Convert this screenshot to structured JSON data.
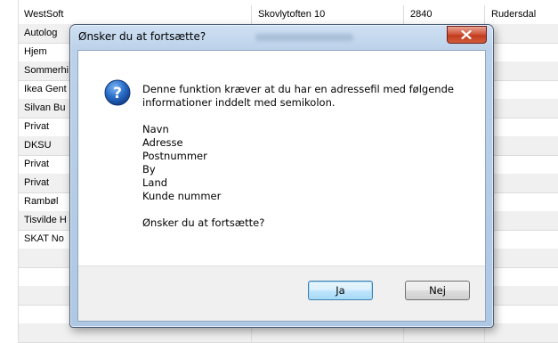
{
  "grid": {
    "rows": [
      {
        "name": "WestSoft",
        "address": "Skovlytoften 10",
        "zip": "2840",
        "city": "Rudersdal"
      },
      {
        "name": "Autolog",
        "address": "",
        "zip": "",
        "city": ""
      },
      {
        "name": "Hjem",
        "address": "",
        "zip": "",
        "city": ""
      },
      {
        "name": "Sommerhi",
        "address": "",
        "zip": "",
        "city": ""
      },
      {
        "name": "Ikea Gent",
        "address": "",
        "zip": "",
        "city": ""
      },
      {
        "name": "Silvan Bu",
        "address": "",
        "zip": "",
        "city": ""
      },
      {
        "name": "Privat",
        "address": "",
        "zip": "",
        "city": ""
      },
      {
        "name": "DKSU",
        "address": "",
        "zip": "",
        "city": ""
      },
      {
        "name": "Privat",
        "address": "",
        "zip": "",
        "city": ""
      },
      {
        "name": "Privat",
        "address": "",
        "zip": "",
        "city": ""
      },
      {
        "name": "Rambøl",
        "address": "",
        "zip": "",
        "city": ""
      },
      {
        "name": "Tisvilde H",
        "address": "",
        "zip": "",
        "city": ""
      },
      {
        "name": "SKAT No",
        "address": "",
        "zip": "",
        "city": ""
      },
      {
        "name": "",
        "address": "",
        "zip": "",
        "city": ""
      },
      {
        "name": "",
        "address": "",
        "zip": "",
        "city": ""
      },
      {
        "name": "",
        "address": "",
        "zip": "",
        "city": ""
      },
      {
        "name": "",
        "address": "",
        "zip": "",
        "city": ""
      },
      {
        "name": "",
        "address": "",
        "zip": "",
        "city": ""
      }
    ]
  },
  "dialog": {
    "title": "Ønsker du at fortsætte?",
    "icon": "information-icon",
    "message_lines": [
      "Denne funktion kræver at du har en adressefil med følgende",
      "informationer inddelt med semikolon."
    ],
    "fields": [
      "Navn",
      "Adresse",
      "Postnummer",
      "By",
      "Land",
      "Kunde nummer"
    ],
    "question": "Ønsker du at fortsætte?",
    "buttons": {
      "yes": "Ja",
      "no": "Nej"
    }
  },
  "colors": {
    "dialog_frame": "#aec7e3",
    "close_button": "#c23b1f",
    "info_icon": "#1f5fb5",
    "primary_button_border": "#3c7fb1"
  }
}
